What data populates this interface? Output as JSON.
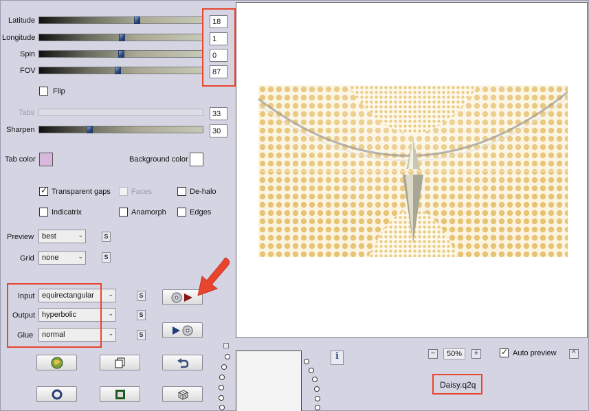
{
  "sliders": [
    {
      "label": "Latitude",
      "value": "18",
      "level": 0.6
    },
    {
      "label": "Longitude",
      "value": "1",
      "level": 0.5
    },
    {
      "label": "Spin",
      "value": "0",
      "level": 0.5
    },
    {
      "label": "FOV",
      "value": "87",
      "level": 0.48
    }
  ],
  "flip": {
    "label": "Flip",
    "checked": false
  },
  "tabs": {
    "label": "Tabs",
    "value": "33",
    "enabled": false
  },
  "sharpen": {
    "label": "Sharpen",
    "value": "30",
    "level": 0.3
  },
  "colors": {
    "tab_color_label": "Tab color",
    "tab_color": "#d8b8dc",
    "background_color_label": "Background color",
    "background_color": "#ffffff",
    "highlight": "#e8452e",
    "panel": "#d4d4e3"
  },
  "options": {
    "transparent_gaps": {
      "label": "Transparent gaps",
      "checked": true
    },
    "faces": {
      "label": "Faces",
      "checked": false,
      "enabled": false
    },
    "dehalo": {
      "label": "De-halo",
      "checked": false
    },
    "indicatrix": {
      "label": "Indicatrix",
      "checked": false
    },
    "anamorph": {
      "label": "Anamorph",
      "checked": false
    },
    "edges": {
      "label": "Edges",
      "checked": false
    }
  },
  "preview_select": {
    "label": "Preview",
    "value": "best"
  },
  "grid_select": {
    "label": "Grid",
    "value": "none"
  },
  "input_select": {
    "label": "Input",
    "value": "equirectangular"
  },
  "output_select": {
    "label": "Output",
    "value": "hyperbolic"
  },
  "glue_select": {
    "label": "Glue",
    "value": "normal"
  },
  "s_button": "S",
  "zoom": {
    "minus": "−",
    "value": "50%",
    "plus": "+"
  },
  "auto_preview": {
    "label": "Auto preview",
    "checked": true
  },
  "collapse": "^",
  "info": "i",
  "filename": "Daisy.q2q",
  "icons": [
    "disc-to-play-icon",
    "play-to-disc-icon",
    "globe-icon",
    "copy-icon",
    "undo-icon",
    "ring-icon",
    "square-icon",
    "dice-icon",
    "info-icon",
    "red-arrow-icon"
  ]
}
